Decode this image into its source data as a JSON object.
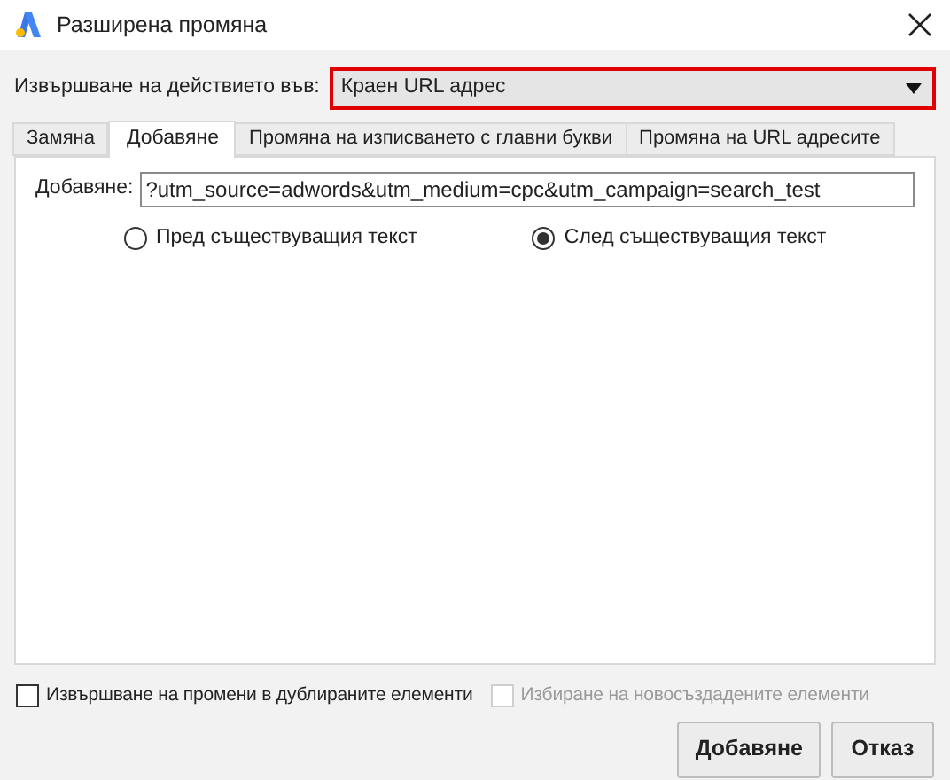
{
  "window": {
    "title": "Разширена промяна"
  },
  "target": {
    "label": "Извършване на действието във:",
    "value": "Краен URL адрес"
  },
  "tabs": [
    {
      "label": "Замяна",
      "selected": false
    },
    {
      "label": "Добавяне",
      "selected": true
    },
    {
      "label": "Промяна на изписването с главни букви",
      "selected": false
    },
    {
      "label": "Промяна на URL адресите",
      "selected": false
    }
  ],
  "append": {
    "label": "Добавяне:",
    "value": "?utm_source=adwords&utm_medium=cpc&utm_campaign=search_test"
  },
  "position": [
    {
      "label": "Пред съществуващия текст",
      "selected": false
    },
    {
      "label": "След съществуващия текст",
      "selected": true
    }
  ],
  "options": [
    {
      "label": "Извършване на промени в дублираните елементи",
      "checked": false,
      "disabled": false
    },
    {
      "label": "Избиране на новосъздадените елементи",
      "checked": false,
      "disabled": true
    }
  ],
  "buttons": [
    {
      "label": "Добавяне",
      "kind": "primary"
    },
    {
      "label": "Отказ",
      "kind": "cancel"
    }
  ]
}
